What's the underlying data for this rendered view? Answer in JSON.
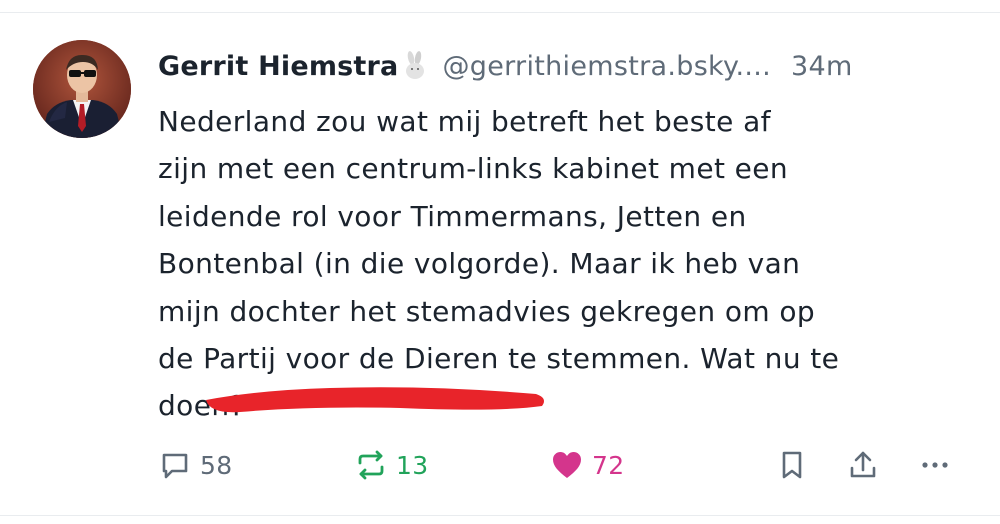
{
  "post": {
    "author": {
      "display_name": "Gerrit Hiemstra",
      "name_emoji": "rabbit-emoji",
      "handle": "@gerrithiemstra.bsky....",
      "avatar": "profile-photo"
    },
    "timestamp": "34m",
    "text_lines": [
      "Nederland zou wat mij betreft het beste af",
      "zijn met een centrum-links kabinet met een",
      "leidende rol voor Timmermans, Jetten en",
      "Bontenbal (in die volgorde). Maar ik heb van",
      "mijn dochter het stemadvies gekregen om op",
      "de Partij voor de Dieren te stemmen. Wat nu te",
      "doen?"
    ],
    "redaction_color": "#e8242a",
    "actions": {
      "reply": {
        "icon": "speech-bubble-icon",
        "count": "58",
        "color": "#5f6b78"
      },
      "repost": {
        "icon": "repost-icon",
        "count": "13",
        "color": "#21a35a"
      },
      "like": {
        "icon": "heart-icon",
        "count": "72",
        "color": "#d4358c"
      },
      "bookmark": {
        "icon": "bookmark-icon"
      },
      "share": {
        "icon": "share-icon"
      },
      "more": {
        "icon": "ellipsis-icon"
      }
    }
  }
}
